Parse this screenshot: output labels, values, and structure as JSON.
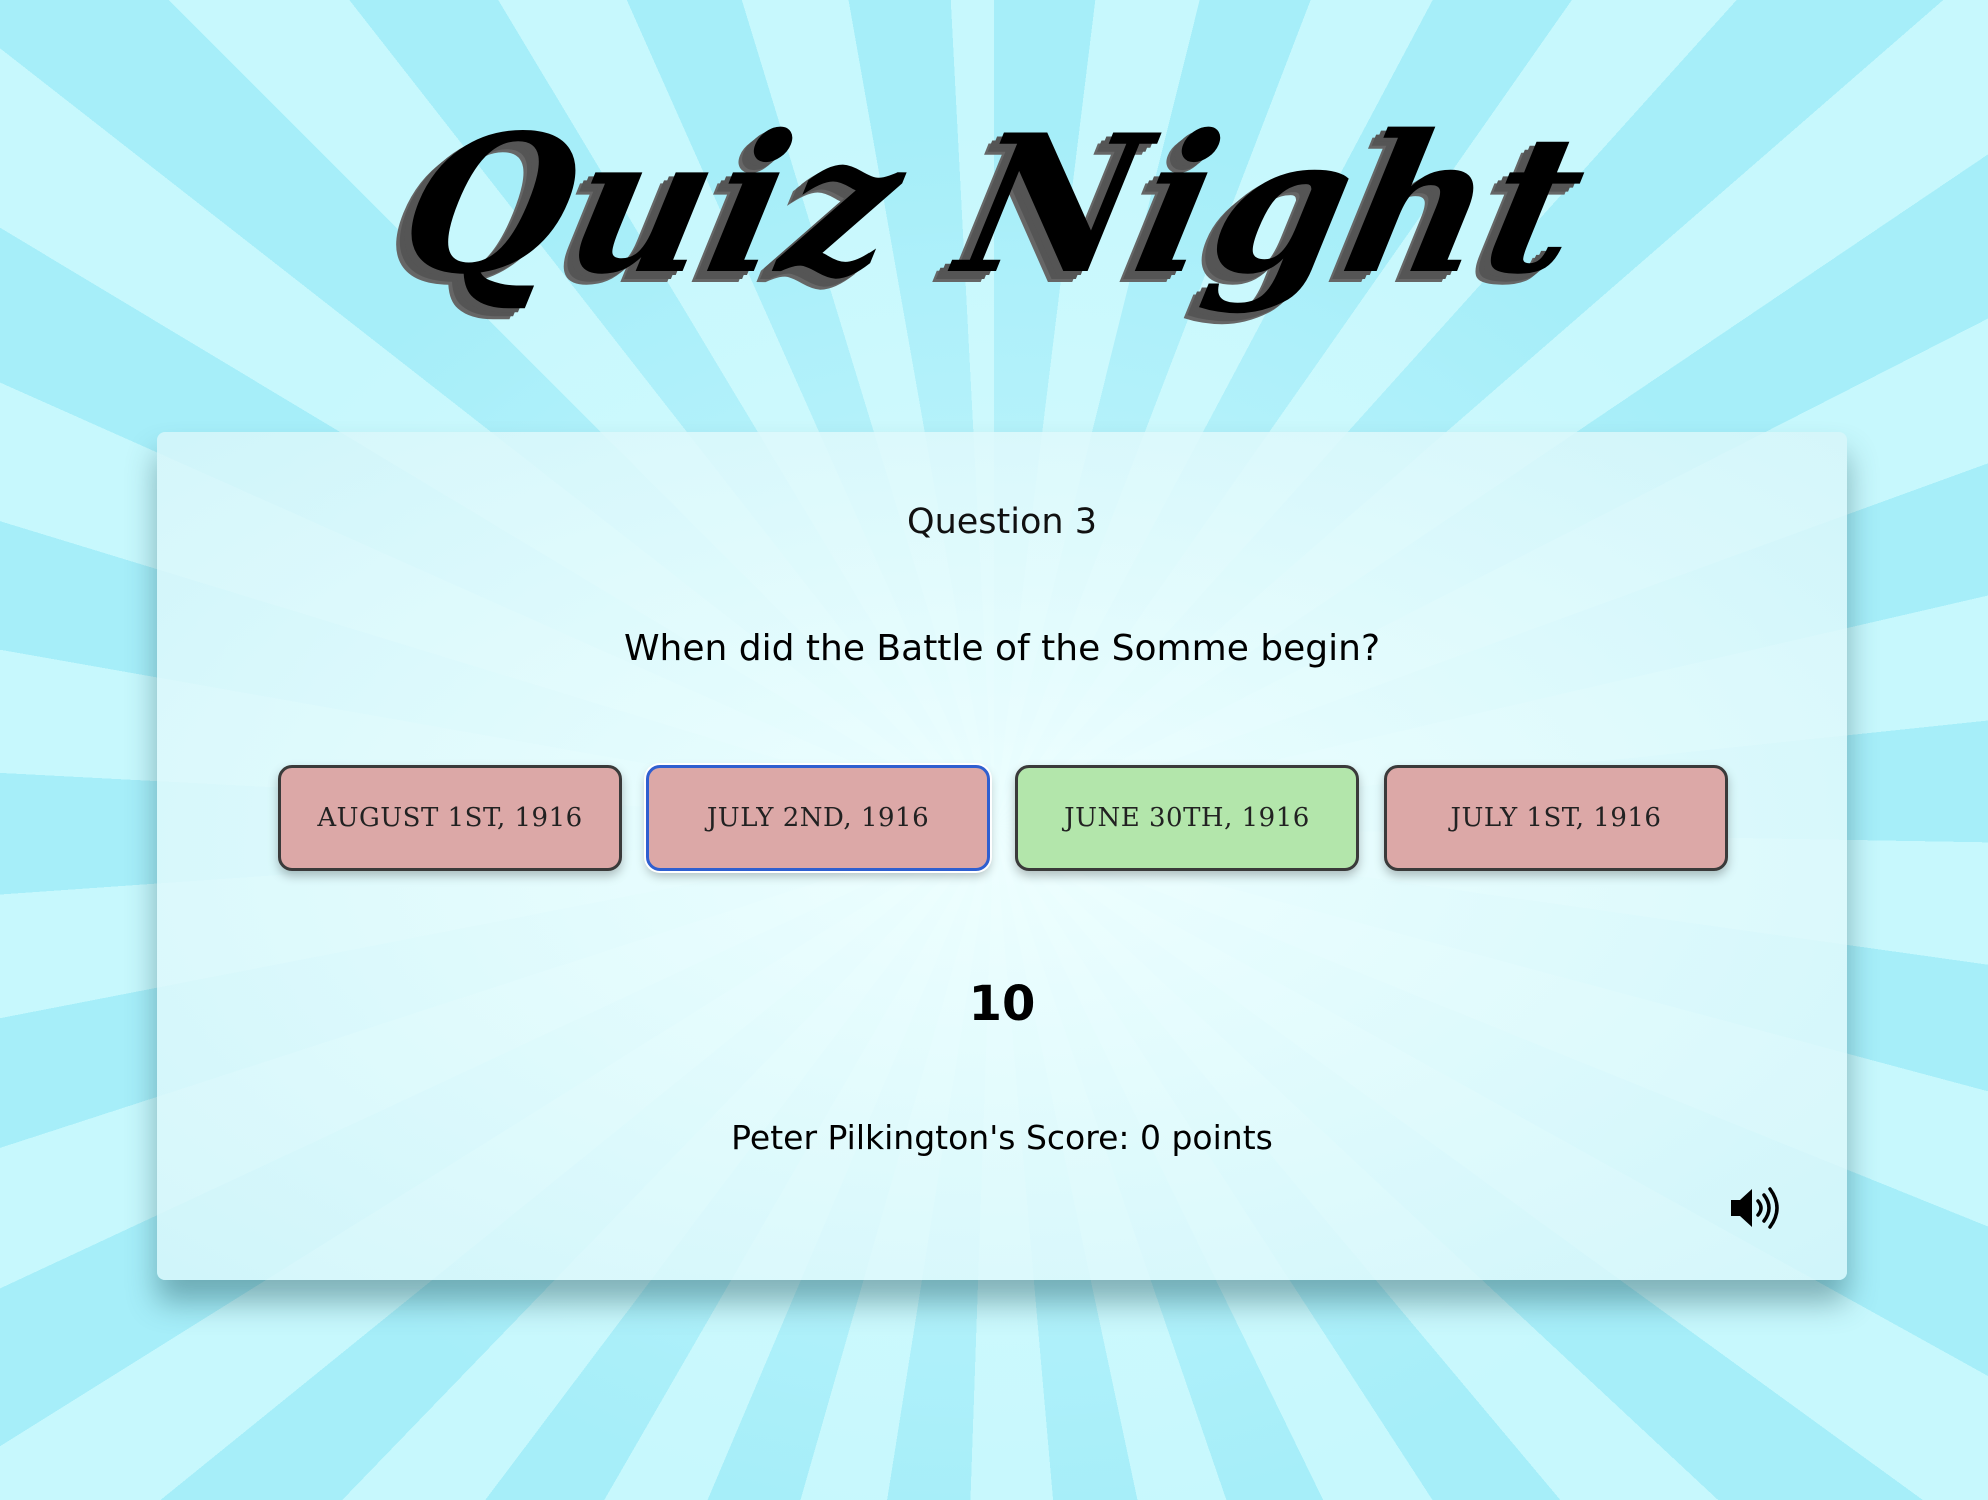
{
  "app": {
    "title": "Quiz Night"
  },
  "quiz": {
    "question_number": "Question 3",
    "question": "When did the Battle of the Somme begin?",
    "answers": [
      {
        "label": "August 1st, 1916",
        "state": "wrong",
        "selected": false
      },
      {
        "label": "July 2nd, 1916",
        "state": "wrong",
        "selected": true
      },
      {
        "label": "June 30th, 1916",
        "state": "right",
        "selected": false
      },
      {
        "label": "July 1st, 1916",
        "state": "wrong",
        "selected": false
      }
    ],
    "timer": "10",
    "score": "Peter Pilkington's Score: 0 points"
  },
  "icons": {
    "sound": "speaker-icon"
  },
  "colors": {
    "wrong_answer": "#dca8a7",
    "right_answer": "#b3e6ab",
    "selected_border": "#2f5fd0",
    "background_light": "#c7f8fd",
    "background_dark": "#a6eef9"
  }
}
